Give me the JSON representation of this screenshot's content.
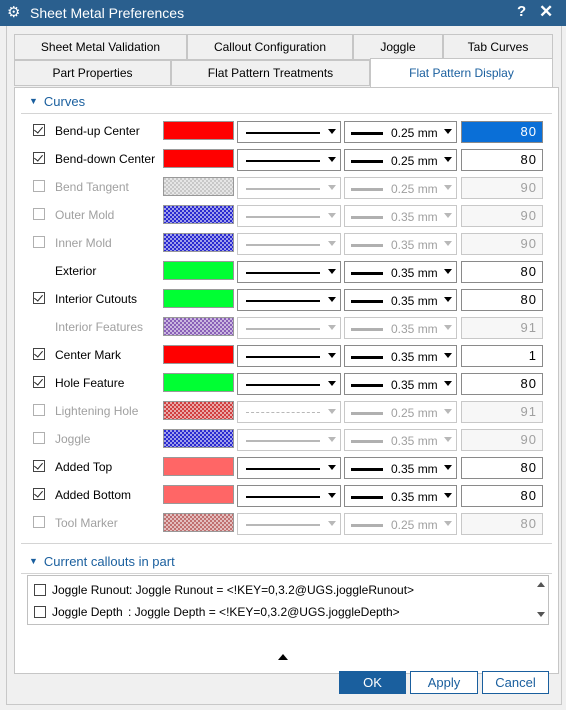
{
  "window": {
    "title": "Sheet Metal Preferences",
    "help": "?",
    "close": "✕"
  },
  "tabs": {
    "row1": [
      "Sheet Metal Validation",
      "Callout Configuration",
      "Joggle",
      "Tab Curves"
    ],
    "row2": [
      "Part Properties",
      "Flat Pattern Treatments",
      "Flat Pattern Display"
    ],
    "active": "Flat Pattern Display"
  },
  "sections": {
    "curves": "Curves",
    "callouts": "Current callouts in part"
  },
  "curves": [
    {
      "label": "Bend-up Center",
      "checked": true,
      "has_checkbox": true,
      "enabled": true,
      "color": "#ff0000",
      "pattern": "solid",
      "width": "0.25 mm",
      "value": "80",
      "selected": true
    },
    {
      "label": "Bend-down Center",
      "checked": true,
      "has_checkbox": true,
      "enabled": true,
      "color": "#ff0000",
      "pattern": "solid",
      "width": "0.25 mm",
      "value": "80"
    },
    {
      "label": "Bend Tangent",
      "checked": false,
      "has_checkbox": true,
      "enabled": false,
      "color": "#c8c8c8",
      "pattern": "solid",
      "width": "0.25 mm",
      "value": "90"
    },
    {
      "label": "Outer Mold",
      "checked": false,
      "has_checkbox": true,
      "enabled": false,
      "color": "#2a2ad0",
      "pattern": "solid",
      "width": "0.35 mm",
      "value": "90"
    },
    {
      "label": "Inner Mold",
      "checked": false,
      "has_checkbox": true,
      "enabled": false,
      "color": "#2a2ad0",
      "pattern": "solid",
      "width": "0.35 mm",
      "value": "90"
    },
    {
      "label": "Exterior",
      "checked": false,
      "has_checkbox": false,
      "enabled": true,
      "color": "#00ff33",
      "pattern": "solid",
      "width": "0.35 mm",
      "value": "80"
    },
    {
      "label": "Interior Cutouts",
      "checked": true,
      "has_checkbox": true,
      "enabled": true,
      "color": "#00ff33",
      "pattern": "solid",
      "width": "0.35 mm",
      "value": "80"
    },
    {
      "label": "Interior Features",
      "checked": false,
      "has_checkbox": false,
      "enabled": false,
      "color": "#8a60b8",
      "pattern": "solid",
      "width": "0.35 mm",
      "value": "91"
    },
    {
      "label": "Center Mark",
      "checked": true,
      "has_checkbox": true,
      "enabled": true,
      "color": "#ff0000",
      "pattern": "solid",
      "width": "0.35 mm",
      "value": "1"
    },
    {
      "label": "Hole Feature",
      "checked": true,
      "has_checkbox": true,
      "enabled": true,
      "color": "#00ff33",
      "pattern": "solid",
      "width": "0.35 mm",
      "value": "80"
    },
    {
      "label": "Lightening Hole",
      "checked": false,
      "has_checkbox": true,
      "enabled": false,
      "color": "#d04040",
      "pattern": "dashdot",
      "width": "0.25 mm",
      "value": "91"
    },
    {
      "label": "Joggle",
      "checked": false,
      "has_checkbox": true,
      "enabled": false,
      "color": "#2a2ad0",
      "pattern": "solid",
      "width": "0.35 mm",
      "value": "90"
    },
    {
      "label": "Added Top",
      "checked": true,
      "has_checkbox": true,
      "enabled": true,
      "color": "#ff6666",
      "pattern": "solid",
      "width": "0.35 mm",
      "value": "80"
    },
    {
      "label": "Added Bottom",
      "checked": true,
      "has_checkbox": true,
      "enabled": true,
      "color": "#ff6666",
      "pattern": "solid",
      "width": "0.35 mm",
      "value": "80"
    },
    {
      "label": "Tool Marker",
      "checked": false,
      "has_checkbox": true,
      "enabled": false,
      "color": "#c07070",
      "pattern": "solid",
      "width": "0.25 mm",
      "value": "80"
    }
  ],
  "callouts": [
    {
      "name": "Joggle Runout",
      "expr": ": Joggle Runout = <!KEY=0,3.2@UGS.joggleRunout>"
    },
    {
      "name": "Joggle Depth",
      "expr": ": Joggle Depth = <!KEY=0,3.2@UGS.joggleDepth>"
    }
  ],
  "buttons": {
    "ok": "OK",
    "apply": "Apply",
    "cancel": "Cancel"
  }
}
